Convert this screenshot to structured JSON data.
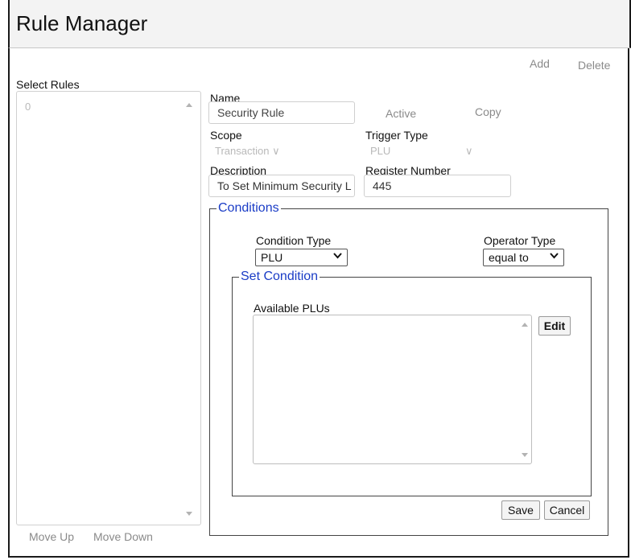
{
  "app": {
    "title": "Rule Manager"
  },
  "toolbar": {
    "add_label": "Add",
    "delete_label": "Delete"
  },
  "rules_list": {
    "label": "Select Rules",
    "items": [
      "0"
    ],
    "move_up_label": "Move Up",
    "move_down_label": "Move Down"
  },
  "form": {
    "name_label": "Name",
    "name_value": "Security Rule",
    "active_label": "Active",
    "copy_label": "Copy",
    "scope_label": "Scope",
    "scope_value": "Transaction",
    "trigger_label": "Trigger Type",
    "trigger_value": "PLU",
    "description_label": "Description",
    "description_value": "To Set Minimum Security L",
    "register_label": "Register Number",
    "register_value": "445"
  },
  "conditions": {
    "legend": "Conditions",
    "condition_type_label": "Condition Type",
    "condition_type_value": "PLU",
    "operator_type_label": "Operator Type",
    "operator_type_value": "equal to",
    "set_condition": {
      "legend": "Set Condition",
      "available_label": "Available PLUs",
      "edit_label": "Edit"
    }
  },
  "actions": {
    "save_label": "Save",
    "cancel_label": "Cancel"
  },
  "colors": {
    "legend": "#1a3cc6",
    "disabled_text": "#b9b9b9",
    "link_gray": "#8a8a8a"
  }
}
